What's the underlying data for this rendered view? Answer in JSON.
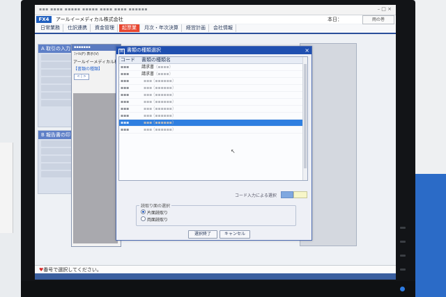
{
  "app": {
    "badge": "FX4",
    "company": "アールイーメディカル株式会社",
    "date_label": "本日：",
    "logo_text": "雨の巻",
    "window_controls": "– □ ×"
  },
  "nav_tabs": [
    "日常業務",
    "仕訳連携",
    "資金管理",
    "起票業",
    "月次・年次決算",
    "経営計画",
    "会社情報"
  ],
  "nav_active_index": 3,
  "panels": {
    "a_title": "A 取引の入力",
    "b_title": "B 報告書の印"
  },
  "sub_window": {
    "menu": "ﾌｧｲﾙ(F) 表示(V)",
    "company": "アールイーメディカル株式会",
    "type_label": "【書類の種類】",
    "nav_button": "< | >"
  },
  "dialog": {
    "title": "書類の種類選択",
    "close": "×",
    "col_code": "コード",
    "col_name": "書類の種類名",
    "rows": [
      {
        "code": "",
        "name": "請求書",
        "selected": false
      },
      {
        "code": "",
        "name": "請求書",
        "selected": false
      },
      {
        "code": "",
        "name": "",
        "selected": false
      },
      {
        "code": "",
        "name": "",
        "selected": false
      },
      {
        "code": "",
        "name": "",
        "selected": false
      },
      {
        "code": "",
        "name": "",
        "selected": false
      },
      {
        "code": "",
        "name": "",
        "selected": false
      },
      {
        "code": "",
        "name": "",
        "selected": false
      },
      {
        "code": "",
        "name": "",
        "selected": true
      },
      {
        "code": "",
        "name": "",
        "selected": false
      }
    ],
    "code_input_label": "コード入力による選択",
    "read_group_title": "読取り面の選択",
    "radio_single": "片面読取り",
    "radio_double": "両面読取り",
    "ok_button": "選択終了",
    "cancel_button": "キャンセル"
  },
  "status": {
    "text": "番号で選択してください。"
  }
}
